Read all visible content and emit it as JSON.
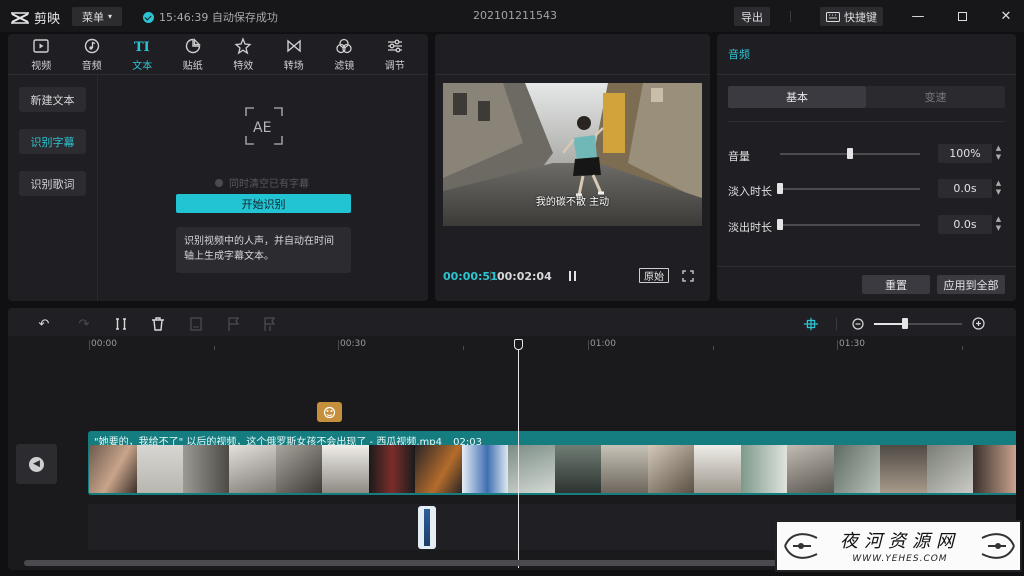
{
  "titlebar": {
    "app_name": "剪映",
    "menu_label": "菜单",
    "status_text": "15:46:39 自动保存成功",
    "project_name": "202101211543",
    "export_label": "导出",
    "shortcut_label": "快捷键"
  },
  "media_tabs": [
    {
      "label": "视频",
      "icon": "video-icon"
    },
    {
      "label": "音频",
      "icon": "audio-icon"
    },
    {
      "label": "文本",
      "icon": "text-icon"
    },
    {
      "label": "贴纸",
      "icon": "sticker-icon"
    },
    {
      "label": "特效",
      "icon": "effects-icon"
    },
    {
      "label": "转场",
      "icon": "transition-icon"
    },
    {
      "label": "滤镜",
      "icon": "filter-icon"
    },
    {
      "label": "调节",
      "icon": "adjust-icon"
    }
  ],
  "text_side": {
    "new_text": "新建文本",
    "recognize_subtitles": "识别字幕",
    "recognize_lyrics": "识别歌词"
  },
  "recognition": {
    "clear_existing": "同时清空已有字幕",
    "start_button": "开始识别",
    "hint": "识别视频中的人声，并自动在时间轴上生成字幕文本。"
  },
  "preview": {
    "subtitle": "我的碳不散 主动",
    "current_time": "00:00:51",
    "total_time": "00:02:04",
    "original_label": "原始"
  },
  "audio_panel": {
    "title": "音频",
    "tab_basic": "基本",
    "tab_speed": "变速",
    "volume_label": "音量",
    "volume_value": "100%",
    "volume_level": 0.5,
    "fade_in_label": "淡入时长",
    "fade_in_value": "0.0s",
    "fade_out_label": "淡出时长",
    "fade_out_value": "0.0s",
    "reset_label": "重置",
    "apply_all_label": "应用到全部"
  },
  "timeline": {
    "ruler": [
      "00:00",
      "00:30",
      "01:00",
      "01:30"
    ],
    "clip_title": "\"她要的，我给不了\" 以后的视频，这个俄罗斯女孩不会出现了 - 西瓜视频.mp4",
    "clip_duration": "02:03",
    "zoom_level": 0.35
  },
  "watermark": {
    "text": "夜河资源网",
    "url": "WWW.YEHES.COM"
  },
  "colors": {
    "accent": "#2ec5d3",
    "clip_header": "#157d80"
  }
}
